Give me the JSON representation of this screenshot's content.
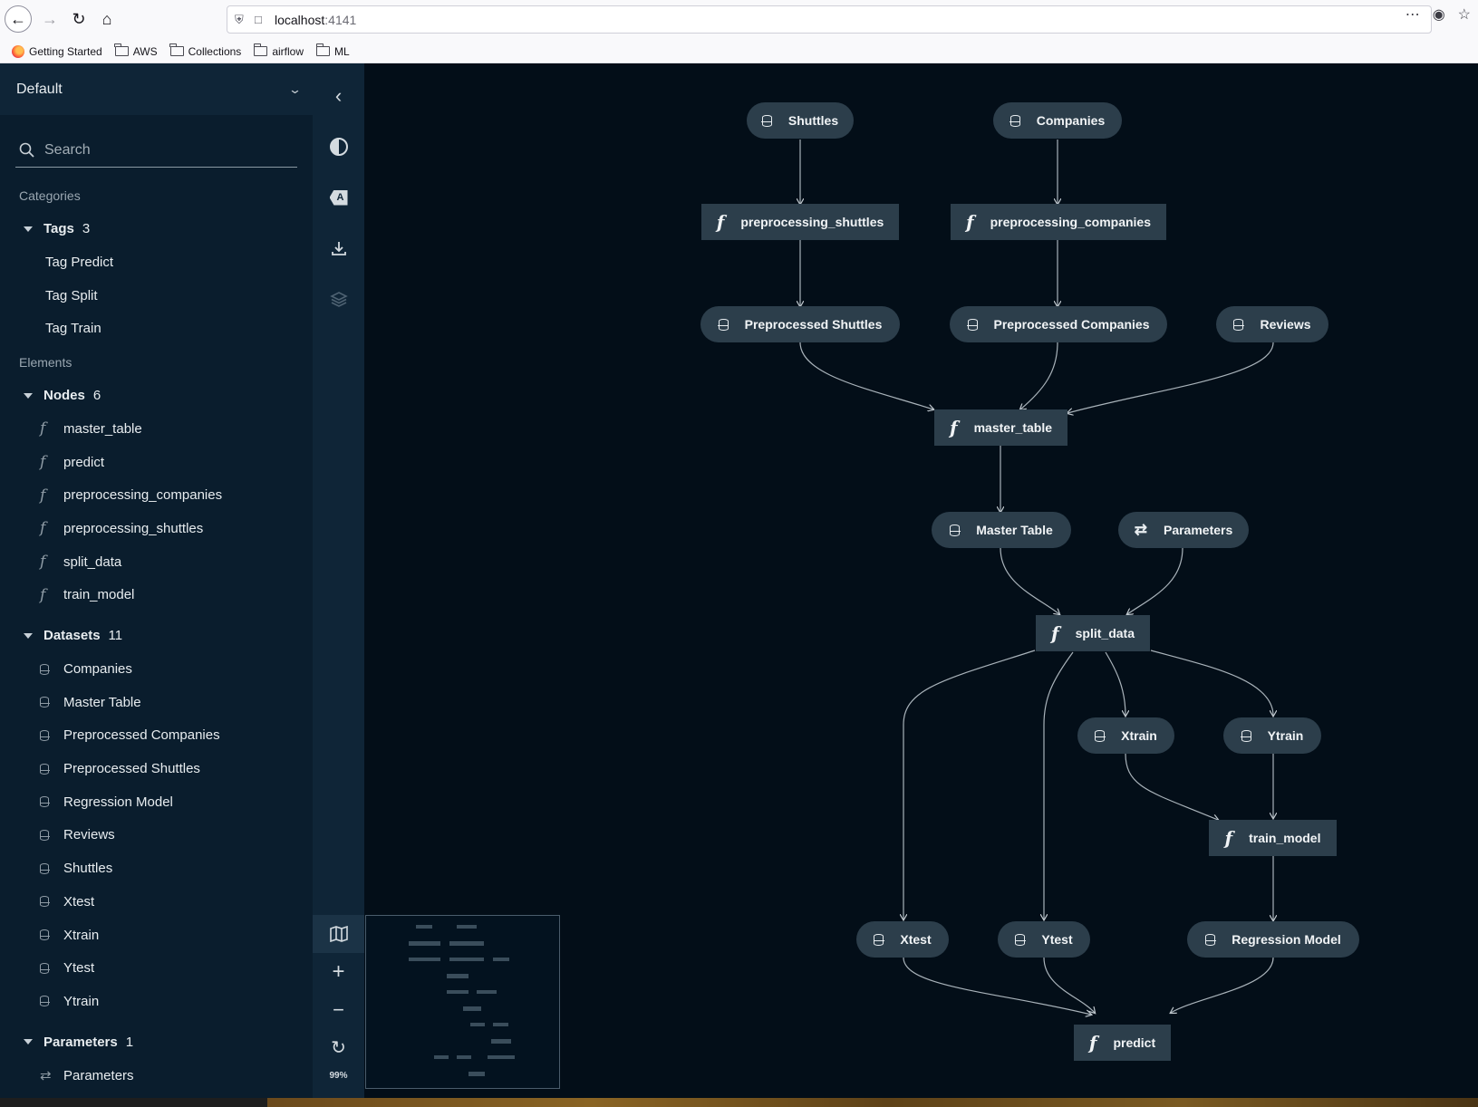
{
  "browser": {
    "url_host": "localhost",
    "url_port": ":4141",
    "bookmarks": [
      {
        "label": "Getting Started",
        "icon": "firefox-icon"
      },
      {
        "label": "AWS",
        "icon": "folder-icon"
      },
      {
        "label": "Collections",
        "icon": "folder-icon"
      },
      {
        "label": "airflow",
        "icon": "folder-icon"
      },
      {
        "label": "ML",
        "icon": "folder-icon"
      }
    ]
  },
  "sidebar": {
    "pipeline": "Default",
    "search_placeholder": "Search",
    "categories_title": "Categories",
    "tags": {
      "label": "Tags",
      "count": "3",
      "items": [
        "Tag Predict",
        "Tag Split",
        "Tag Train"
      ]
    },
    "elements_title": "Elements",
    "nodes": {
      "label": "Nodes",
      "count": "6",
      "items": [
        "master_table",
        "predict",
        "preprocessing_companies",
        "preprocessing_shuttles",
        "split_data",
        "train_model"
      ]
    },
    "datasets": {
      "label": "Datasets",
      "count": "11",
      "items": [
        "Companies",
        "Master Table",
        "Preprocessed Companies",
        "Preprocessed Shuttles",
        "Regression Model",
        "Reviews",
        "Shuttles",
        "Xtest",
        "Xtrain",
        "Ytest",
        "Ytrain"
      ]
    },
    "parameters": {
      "label": "Parameters",
      "count": "1",
      "items": [
        "Parameters"
      ]
    }
  },
  "toolbar": {
    "zoom_level": "99%",
    "label_icon_text": "A"
  },
  "graph": {
    "nodes": {
      "shuttles": {
        "label": "Shuttles",
        "type": "data"
      },
      "companies": {
        "label": "Companies",
        "type": "data"
      },
      "pre_shuttles_fn": {
        "label": "preprocessing_shuttles",
        "type": "task"
      },
      "pre_companies_fn": {
        "label": "preprocessing_companies",
        "type": "task"
      },
      "pre_shuttles": {
        "label": "Preprocessed Shuttles",
        "type": "data"
      },
      "pre_companies": {
        "label": "Preprocessed Companies",
        "type": "data"
      },
      "reviews": {
        "label": "Reviews",
        "type": "data"
      },
      "master_table_fn": {
        "label": "master_table",
        "type": "task"
      },
      "master_table": {
        "label": "Master Table",
        "type": "data"
      },
      "parameters": {
        "label": "Parameters",
        "type": "param"
      },
      "split_data": {
        "label": "split_data",
        "type": "task"
      },
      "xtrain": {
        "label": "Xtrain",
        "type": "data"
      },
      "ytrain": {
        "label": "Ytrain",
        "type": "data"
      },
      "train_model": {
        "label": "train_model",
        "type": "task"
      },
      "xtest": {
        "label": "Xtest",
        "type": "data"
      },
      "ytest": {
        "label": "Ytest",
        "type": "data"
      },
      "regression_model": {
        "label": "Regression Model",
        "type": "data"
      },
      "predict": {
        "label": "predict",
        "type": "task"
      }
    }
  }
}
